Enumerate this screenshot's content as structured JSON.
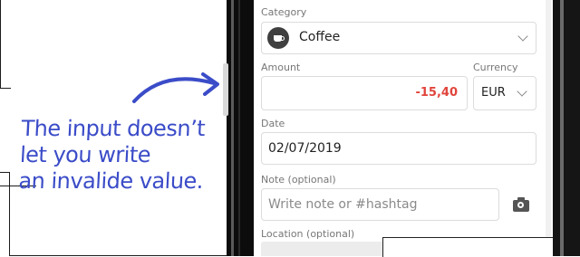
{
  "annotation": {
    "lines": [
      "The input doesn’t",
      "let you write",
      "an invalide value."
    ],
    "color": "#3b4cc8"
  },
  "form": {
    "category": {
      "label": "Category",
      "value": "Coffee",
      "icon": "coffee-cup-icon"
    },
    "amount": {
      "label": "Amount",
      "value": "-15,40",
      "value_color": "#e0443c"
    },
    "currency": {
      "label": "Currency",
      "value": "EUR"
    },
    "date": {
      "label": "Date",
      "value": "02/07/2019"
    },
    "note": {
      "label": "Note (optional)",
      "placeholder": "Write note or #hashtag",
      "attach_icon": "camera-icon"
    },
    "location": {
      "label": "Location (optional)"
    }
  }
}
